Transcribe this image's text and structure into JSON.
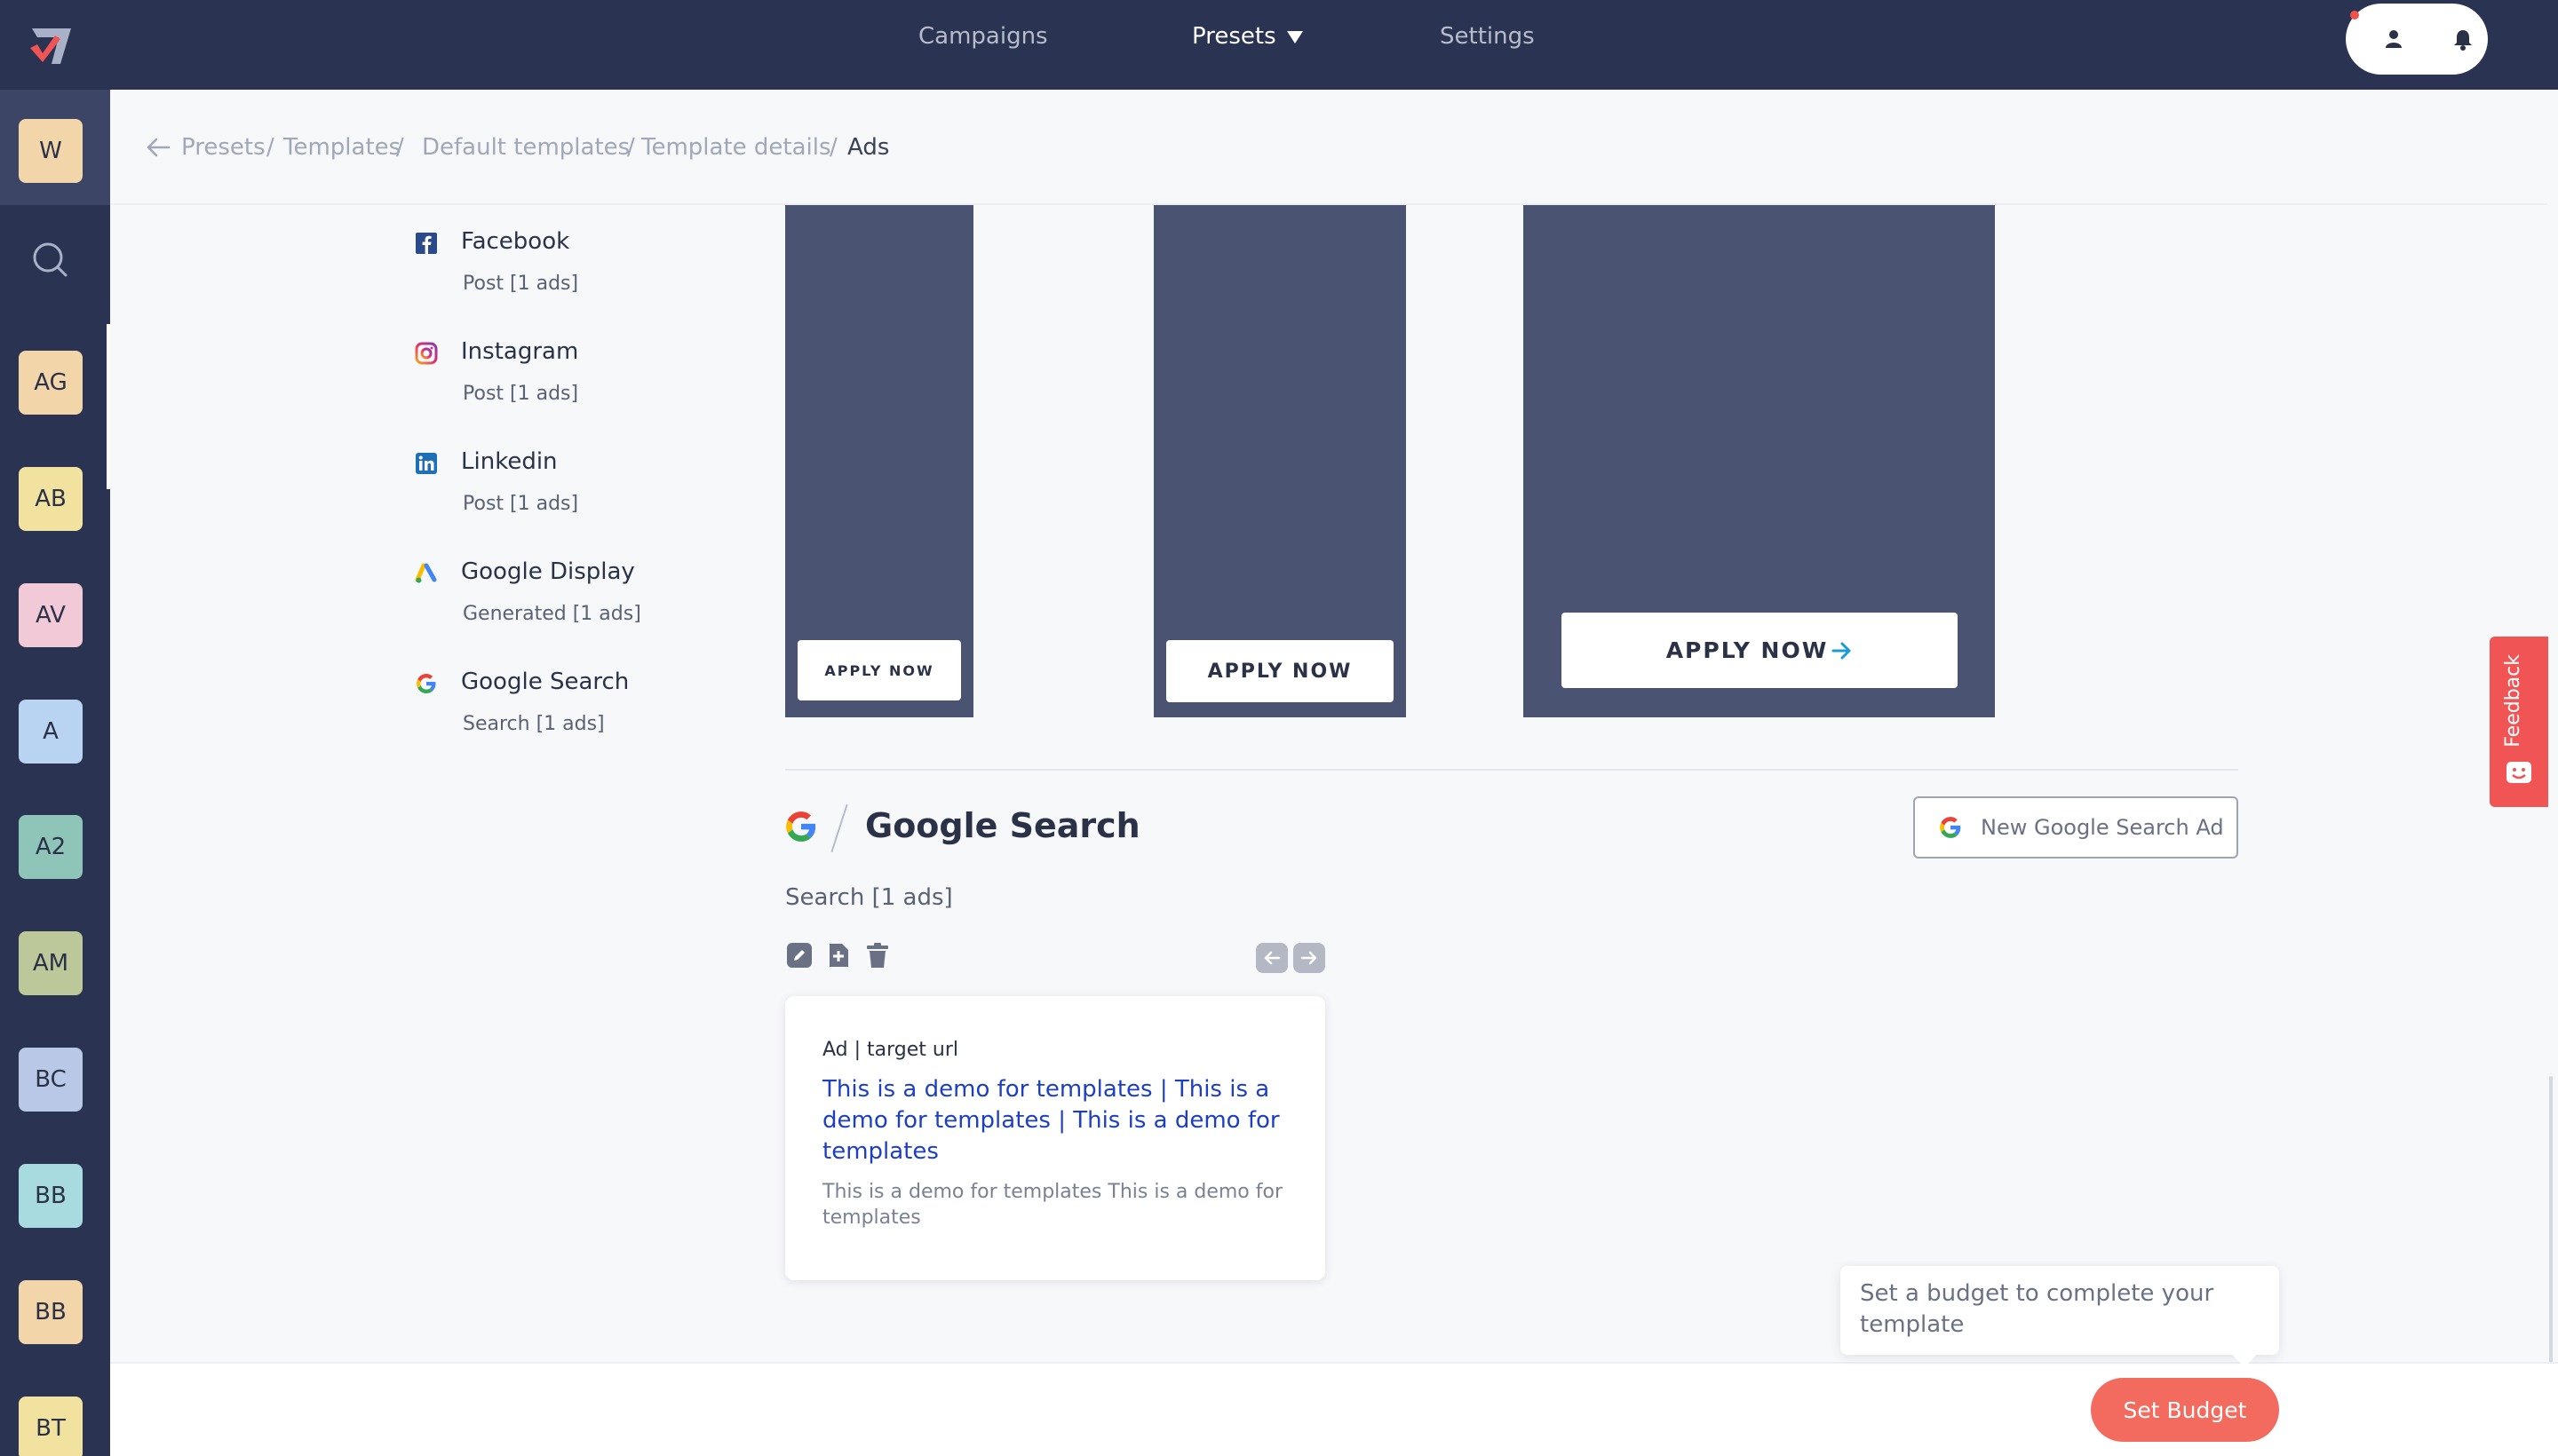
{
  "topnav": {
    "items": [
      {
        "label": "Campaigns"
      },
      {
        "label": "Presets"
      },
      {
        "label": "Settings"
      }
    ]
  },
  "workspaces": [
    "W",
    "AG",
    "AB",
    "AV",
    "A",
    "A2",
    "AM",
    "BC",
    "BB",
    "BB",
    "BT"
  ],
  "breadcrumb": {
    "items": [
      "Presets",
      "/",
      "Templates",
      "/",
      "Default templates",
      "/",
      "Template details",
      "/",
      "Ads"
    ]
  },
  "platforms": [
    {
      "name": "Facebook",
      "sub": "Post [1 ads]"
    },
    {
      "name": "Instagram",
      "sub": "Post [1 ads]"
    },
    {
      "name": "Linkedin",
      "sub": "Post [1 ads]"
    },
    {
      "name": "Google Display",
      "sub": "Generated [1 ads]"
    },
    {
      "name": "Google Search",
      "sub": "Search [1 ads]"
    }
  ],
  "previews": [
    {
      "cta": "APPLY NOW"
    },
    {
      "cta": "APPLY NOW"
    },
    {
      "cta": "APPLY NOW"
    }
  ],
  "google_search": {
    "title": "Google Search",
    "new_button": "New Google Search Ad",
    "count": "Search [1 ads]",
    "ad": {
      "url": "Ad | target url",
      "headline": "This is a demo for templates | This is a demo for templates | This is a demo for templates",
      "description": "This is a demo for templates This is a demo for templates"
    }
  },
  "feedback": {
    "label": "Feedback"
  },
  "footer": {
    "tooltip": "Set a budget to complete your template",
    "set_budget": "Set Budget"
  },
  "colors": {
    "nav_bg": "#2b3352",
    "accent": "#f36b5e",
    "link": "#1d3fc4",
    "preview_bg": "#4b5373"
  }
}
